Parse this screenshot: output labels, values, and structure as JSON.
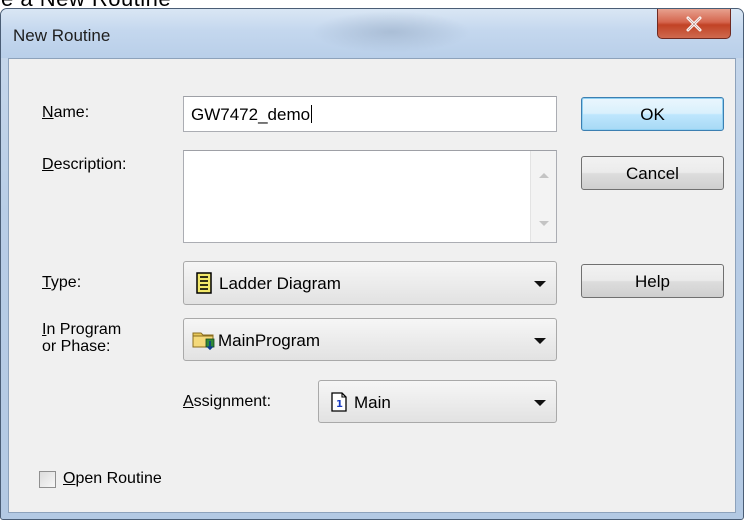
{
  "background": {
    "partial_text": "e a New Routine"
  },
  "dialog": {
    "title": "New Routine",
    "close_label": "X"
  },
  "fields": {
    "name": {
      "label_accel": "N",
      "label_rest": "ame:",
      "value": "GW7472_demo"
    },
    "description": {
      "label_accel": "D",
      "label_rest": "escription:",
      "value": ""
    },
    "type": {
      "label_accel": "T",
      "label_rest": "ype:",
      "value": "Ladder Diagram",
      "icon": "ladder-diagram-icon"
    },
    "program": {
      "label_accel": "I",
      "label_line1_rest": "n Program",
      "label_line2": "or Phase:",
      "value": "MainProgram",
      "icon": "program-folder-icon"
    },
    "assignment": {
      "label_accel": "A",
      "label_rest": "ssignment:",
      "value": "Main",
      "icon": "main-routine-icon"
    }
  },
  "buttons": {
    "ok": "OK",
    "cancel": "Cancel",
    "help": "Help"
  },
  "open_routine": {
    "label_accel": "O",
    "label_rest": "pen Routine",
    "checked": false
  },
  "colors": {
    "title_bar": "#c4d7ee",
    "close_button": "#c14225",
    "client_bg": "#f0f0f0",
    "default_button_border": "#3c7fb1"
  }
}
